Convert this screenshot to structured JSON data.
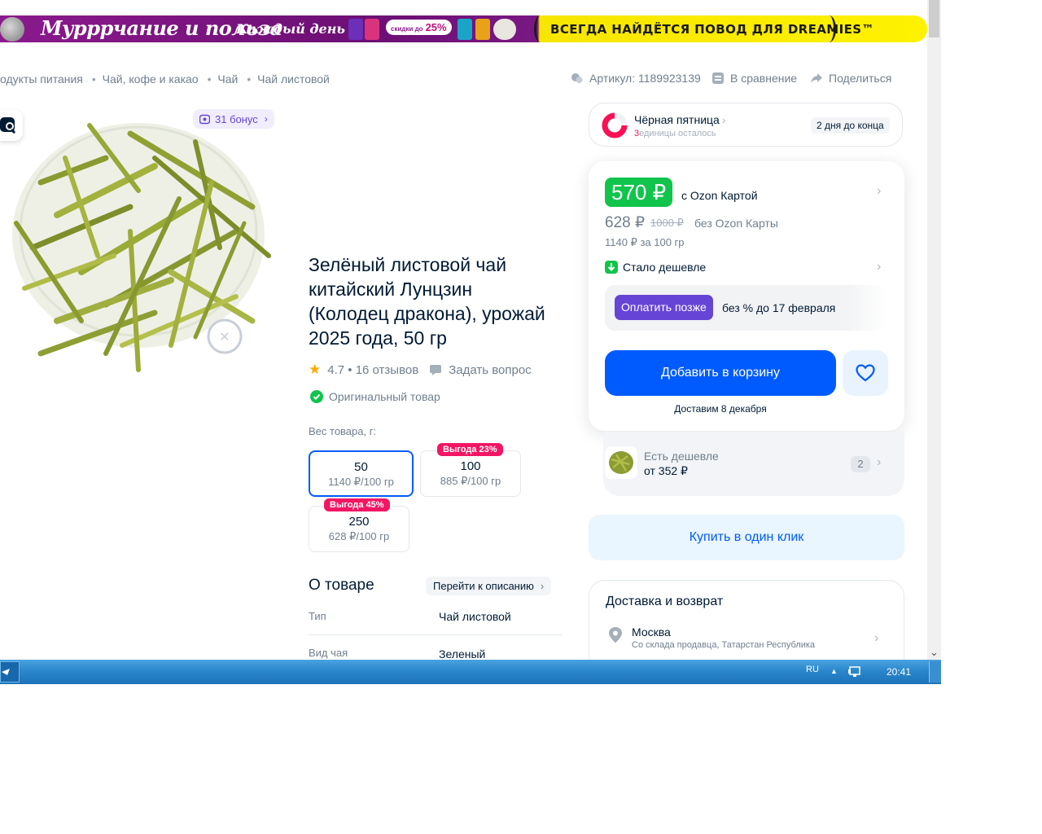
{
  "banner": {
    "headline": "Мурррчание и польза",
    "sub": "Каждый день",
    "discount_small": "скидки до",
    "discount": "25%",
    "slogan": "ВСЕГДА НАЙДЁТСЯ ПОВОД ДЛЯ DREAMIES™"
  },
  "breadcrumbs": [
    "одукты питания",
    "Чай, кофе и какао",
    "Чай",
    "Чай листовой"
  ],
  "top_info": {
    "article": "Артикул: 1189923139",
    "compare": "В сравнение",
    "share": "Поделиться"
  },
  "product": {
    "bonus": "31 бонус",
    "title": "Зелёный листовой чай китайский Лунцзин (Колодец дракона), урожай 2025 года, 50 гр",
    "rating": "4.7 • 16 отзывов",
    "ask": "Задать вопрос",
    "original": "Оригинальный товар",
    "weight_label": "Вес товара, г:",
    "weights": [
      {
        "value": "50",
        "price": "1140 ₽/100 гр",
        "badge": ""
      },
      {
        "value": "100",
        "price": "885 ₽/100 гр",
        "badge": "Выгода 23%"
      },
      {
        "value": "250",
        "price": "628 ₽/100 гр",
        "badge": "Выгода 45%"
      }
    ],
    "about_title": "О товаре",
    "goto_description": "Перейти к описанию",
    "specs": [
      {
        "label": "Тип",
        "value": "Чай листовой"
      },
      {
        "label": "Вид чая",
        "value": "Зеленый"
      }
    ]
  },
  "promo": {
    "title": "Чёрная пятница",
    "units_num": "3",
    "units_text": "единицы осталось",
    "days_left": "2 дня до конца"
  },
  "pricing": {
    "card_price": "570 ₽",
    "card_label": "с Ozon Картой",
    "regular_price": "628 ₽",
    "old_price": "1000 ₽",
    "regular_label": "без Ozon Карты",
    "unit_price": "1140 ₽ за 100 гр",
    "cheaper_now": "Стало дешевле",
    "pay_later": "Оплатить позже",
    "pay_later_terms": "без % до 17 февраля",
    "add_to_cart": "Добавить в корзину",
    "delivery_date": "Доставим 8 декабря"
  },
  "cheaper_offer": {
    "label": "Есть дешевле",
    "price": "от 352 ₽",
    "count": "2"
  },
  "buy_one_click": "Купить в один клик",
  "delivery": {
    "title": "Доставка и возврат",
    "city": "Москва",
    "source": "Со склада продавца, Татарстан Республика"
  },
  "taskbar": {
    "lang": "RU",
    "time": "20:41"
  },
  "colors": {
    "accent_blue": "#005bff",
    "price_green": "#10c44c",
    "badge_pink": "#f21664",
    "bnpl_purple": "#6645d6"
  }
}
